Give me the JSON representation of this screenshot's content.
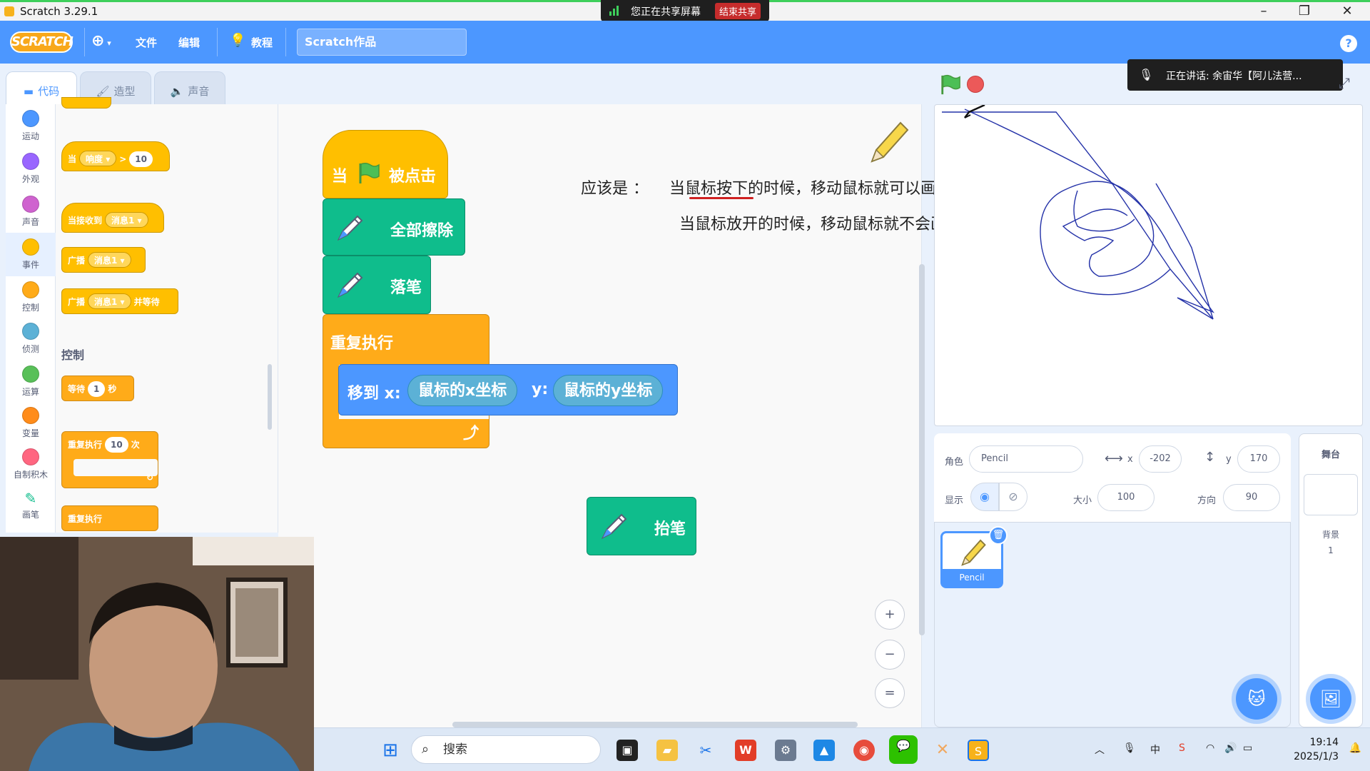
{
  "window": {
    "title": "Scratch 3.29.1"
  },
  "share_banner": {
    "text": "您正在共享屏幕",
    "stop_label": "结束共享"
  },
  "menubar": {
    "logo": "SCRATCH",
    "file": "文件",
    "edit": "编辑",
    "tutorials": "教程",
    "project_name": "Scratch作品",
    "help": "?"
  },
  "tabs": {
    "code": "代码",
    "costumes": "造型",
    "sounds": "声音"
  },
  "categories": [
    {
      "label": "运动",
      "color": "#4c97ff"
    },
    {
      "label": "外观",
      "color": "#9966ff"
    },
    {
      "label": "声音",
      "color": "#cf63cf"
    },
    {
      "label": "事件",
      "color": "#ffbf00"
    },
    {
      "label": "控制",
      "color": "#ffab19"
    },
    {
      "label": "侦测",
      "color": "#5cb1d6"
    },
    {
      "label": "运算",
      "color": "#59c059"
    },
    {
      "label": "变量",
      "color": "#ff8c1a"
    },
    {
      "label": "自制积木",
      "color": "#ff6680"
    },
    {
      "label": "画笔",
      "color": "#0fbd8c"
    }
  ],
  "palette": {
    "when_gt": {
      "when": "当",
      "sensor": "响度",
      "op": ">",
      "value": "10"
    },
    "when_receive": {
      "label": "当接收到",
      "msg": "消息1"
    },
    "broadcast": {
      "label": "广播",
      "msg": "消息1"
    },
    "broadcast_wait": {
      "label": "广播",
      "msg": "消息1",
      "suffix": "并等待"
    },
    "control_header": "控制",
    "wait": {
      "label": "等待",
      "value": "1",
      "unit": "秒"
    },
    "repeat_n": {
      "label": "重复执行",
      "value": "10",
      "unit": "次"
    },
    "forever": "重复执行"
  },
  "script": {
    "hat_when": "当",
    "hat_clicked": "被点击",
    "clear": "全部擦除",
    "pen_down": "落笔",
    "forever": "重复执行",
    "goto_prefix": "移到 x:",
    "goto_x": "鼠标的x坐标",
    "goto_y_label": "y:",
    "goto_y": "鼠标的y坐标",
    "pen_up": "抬笔"
  },
  "annotation": {
    "line1_prefix": "应该是  ：",
    "line1": "当鼠标按下的时候，移动鼠标就可以画线；",
    "line2": "当鼠标放开的时候，移动鼠标就不会画线"
  },
  "zoom": {
    "in": "+",
    "out": "−",
    "reset": "="
  },
  "speaking": {
    "text": "正在讲话:  余宙华【阿儿法营..."
  },
  "sprite": {
    "label": "角色",
    "name": "Pencil",
    "x_label": "x",
    "x": "-202",
    "y_label": "y",
    "y": "170",
    "show_label": "显示",
    "size_label": "大小",
    "size": "100",
    "direction_label": "方向",
    "direction": "90"
  },
  "stage_pane": {
    "title": "舞台",
    "backdrops_label": "背景",
    "backdrops_count": "1"
  },
  "taskbar": {
    "search": "搜索",
    "time": "19:14",
    "date": "2025/1/3",
    "ime": "中"
  }
}
